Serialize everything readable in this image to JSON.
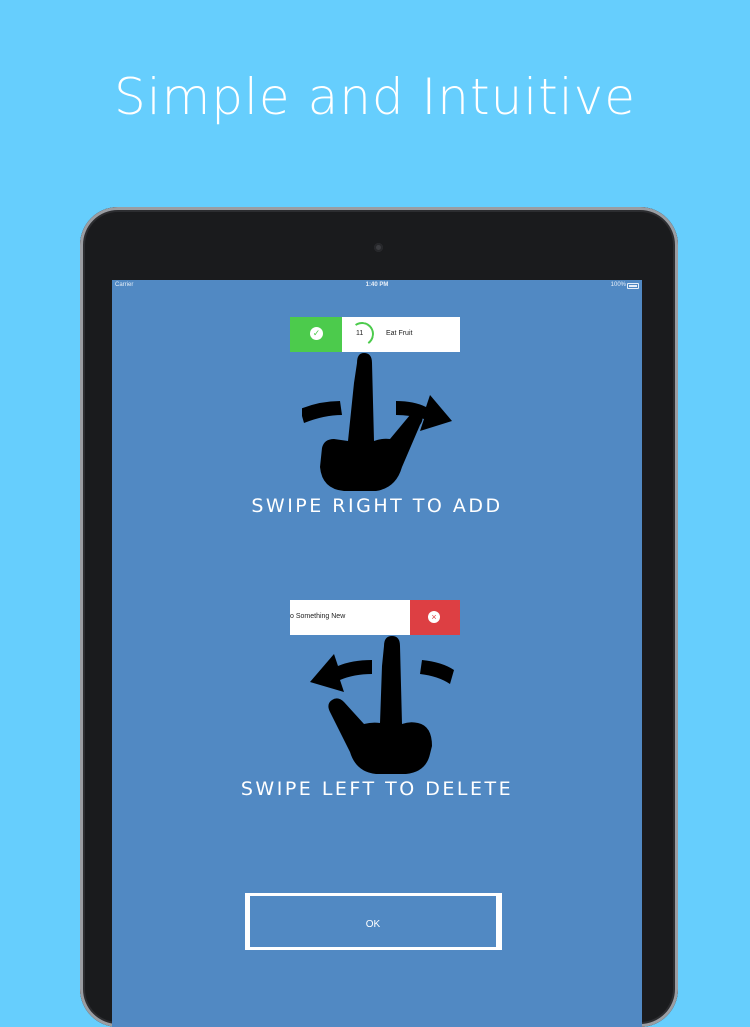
{
  "headline": "Simple and Intuitive",
  "status_bar": {
    "carrier": "Carrier",
    "time": "1:40 PM",
    "battery": "100%"
  },
  "add_demo": {
    "count": "11",
    "task_label": "Eat Fruit",
    "action_icon": "checkmark-icon",
    "caption": "SWIPE RIGHT TO ADD",
    "action_color": "#4ccb4c"
  },
  "delete_demo": {
    "task_label": "o Something New",
    "action_icon": "x-icon",
    "caption": "SWIPE LEFT TO DELETE",
    "action_color": "#dd3f43"
  },
  "ok_button": {
    "label": "OK"
  },
  "colors": {
    "background": "#66cefd",
    "screen": "#5189c3",
    "device": "#1a1b1d"
  }
}
